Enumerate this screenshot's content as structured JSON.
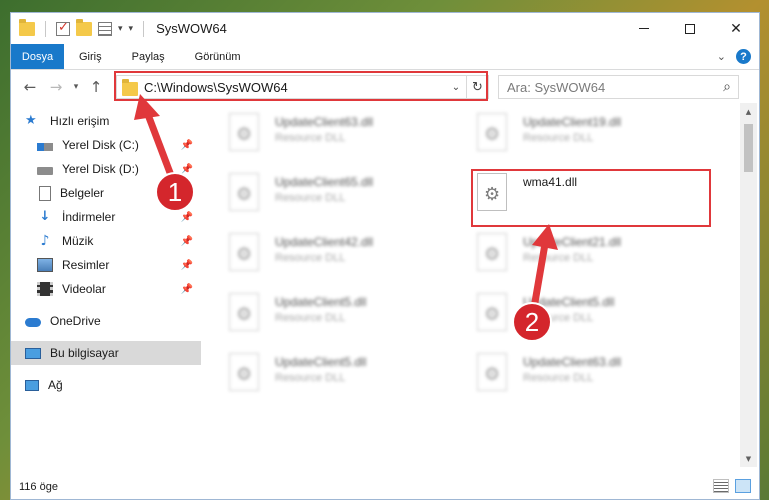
{
  "window": {
    "title": "SysWOW64"
  },
  "ribbon": {
    "tabs": [
      "Dosya",
      "Giriş",
      "Paylaş",
      "Görünüm"
    ],
    "help_label": "?"
  },
  "nav": {
    "address": "C:\\Windows\\SysWOW64",
    "search_placeholder": "Ara: SysWOW64"
  },
  "sidebar": {
    "items": [
      {
        "label": "Hızlı erişim",
        "icon": "star-icon",
        "pinned": false
      },
      {
        "label": "Yerel Disk (C:)",
        "icon": "drive-icon",
        "pinned": true
      },
      {
        "label": "Yerel Disk (D:)",
        "icon": "drive-icon",
        "pinned": true
      },
      {
        "label": "Belgeler",
        "icon": "document-icon",
        "pinned": true
      },
      {
        "label": "İndirmeler",
        "icon": "download-icon",
        "pinned": true
      },
      {
        "label": "Müzik",
        "icon": "music-icon",
        "pinned": true
      },
      {
        "label": "Resimler",
        "icon": "pictures-icon",
        "pinned": true
      },
      {
        "label": "Videolar",
        "icon": "video-icon",
        "pinned": true
      },
      {
        "label": "OneDrive",
        "icon": "cloud-icon",
        "pinned": false
      },
      {
        "label": "Bu bilgisayar",
        "icon": "computer-icon",
        "pinned": false,
        "selected": true
      },
      {
        "label": "Ağ",
        "icon": "network-icon",
        "pinned": false
      }
    ]
  },
  "files": {
    "left_column": [
      {
        "name": "UpdateClient63.dll",
        "type": "Resource DLL"
      },
      {
        "name": "UpdateClient65.dll",
        "type": "Resource DLL"
      },
      {
        "name": "UpdateClient42.dll",
        "type": "Resource DLL"
      },
      {
        "name": "UpdateClient5.dll",
        "type": "Resource DLL"
      },
      {
        "name": "UpdateClient5.dll",
        "type": "Resource DLL"
      }
    ],
    "right_column": [
      {
        "name": "UpdateClient19.dll",
        "type": "Resource DLL"
      },
      {
        "name": "wma41.dll",
        "type": ""
      },
      {
        "name": "UpdateClient21.dll",
        "type": "Resource DLL"
      },
      {
        "name": "UpdateClient5.dll",
        "type": "Resource DLL"
      },
      {
        "name": "UpdateClient63.dll",
        "type": "Resource DLL"
      }
    ]
  },
  "status": {
    "count": "116 öge"
  },
  "annotations": {
    "step1": "1",
    "step2": "2",
    "color": "#e0383b"
  }
}
